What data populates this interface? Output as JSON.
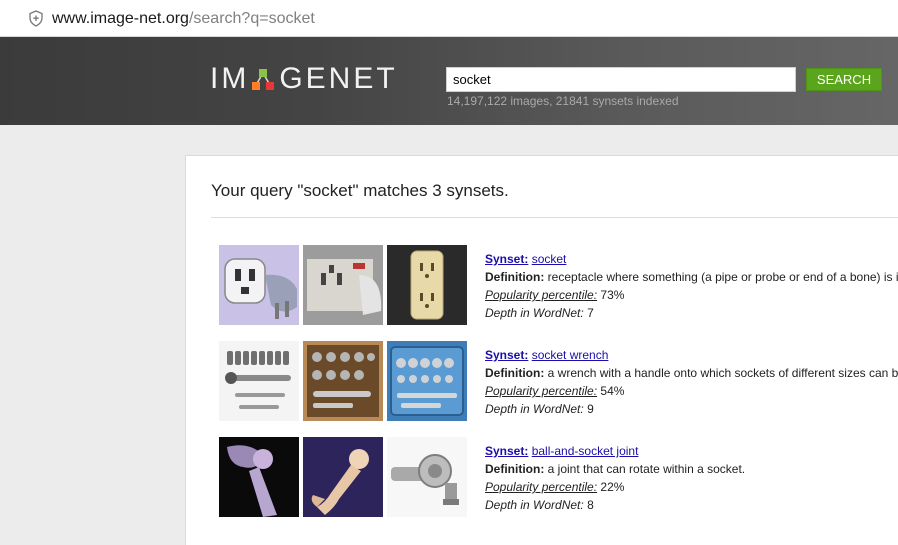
{
  "browser": {
    "url_host": "www.image-net.org",
    "url_path": "/search?q=socket"
  },
  "header": {
    "logo_left": "IM",
    "logo_right": "GENET",
    "search_value": "socket",
    "search_button": "SEARCH",
    "index_stats": "14,197,122 images, 21841 synsets indexed"
  },
  "results_header": {
    "query_message": "Your query \"socket\" matches 3 synsets."
  },
  "labels": {
    "synset": "Synset:",
    "definition": "Definition:",
    "popularity": "Popularity percentile:",
    "depth": "Depth in WordNet:"
  },
  "results": [
    {
      "synset": "socket",
      "definition": "receptacle where something (a pipe or probe or end of a bone) is inserted",
      "popularity": "73%",
      "depth": "7",
      "thumbnails": [
        "three-prong-plug-image",
        "wall-socket-image",
        "duplex-outlet-image"
      ]
    },
    {
      "synset": "socket wrench",
      "definition": "a wrench with a handle onto which sockets of different sizes can be fitted",
      "popularity": "54%",
      "depth": "9",
      "thumbnails": [
        "socket-set-tools-image",
        "socket-wrench-case-image",
        "blue-socket-set-case-image"
      ]
    },
    {
      "synset": "ball-and-socket joint",
      "definition": "a joint that can rotate within a socket.",
      "popularity": "22%",
      "depth": "8",
      "thumbnails": [
        "hip-joint-xray-image",
        "femur-bone-image",
        "ball-joint-rod-end-image"
      ]
    }
  ],
  "colors": {
    "header_bg": "#444444",
    "search_button": "#5aa51b",
    "link": "#1a0dab"
  }
}
